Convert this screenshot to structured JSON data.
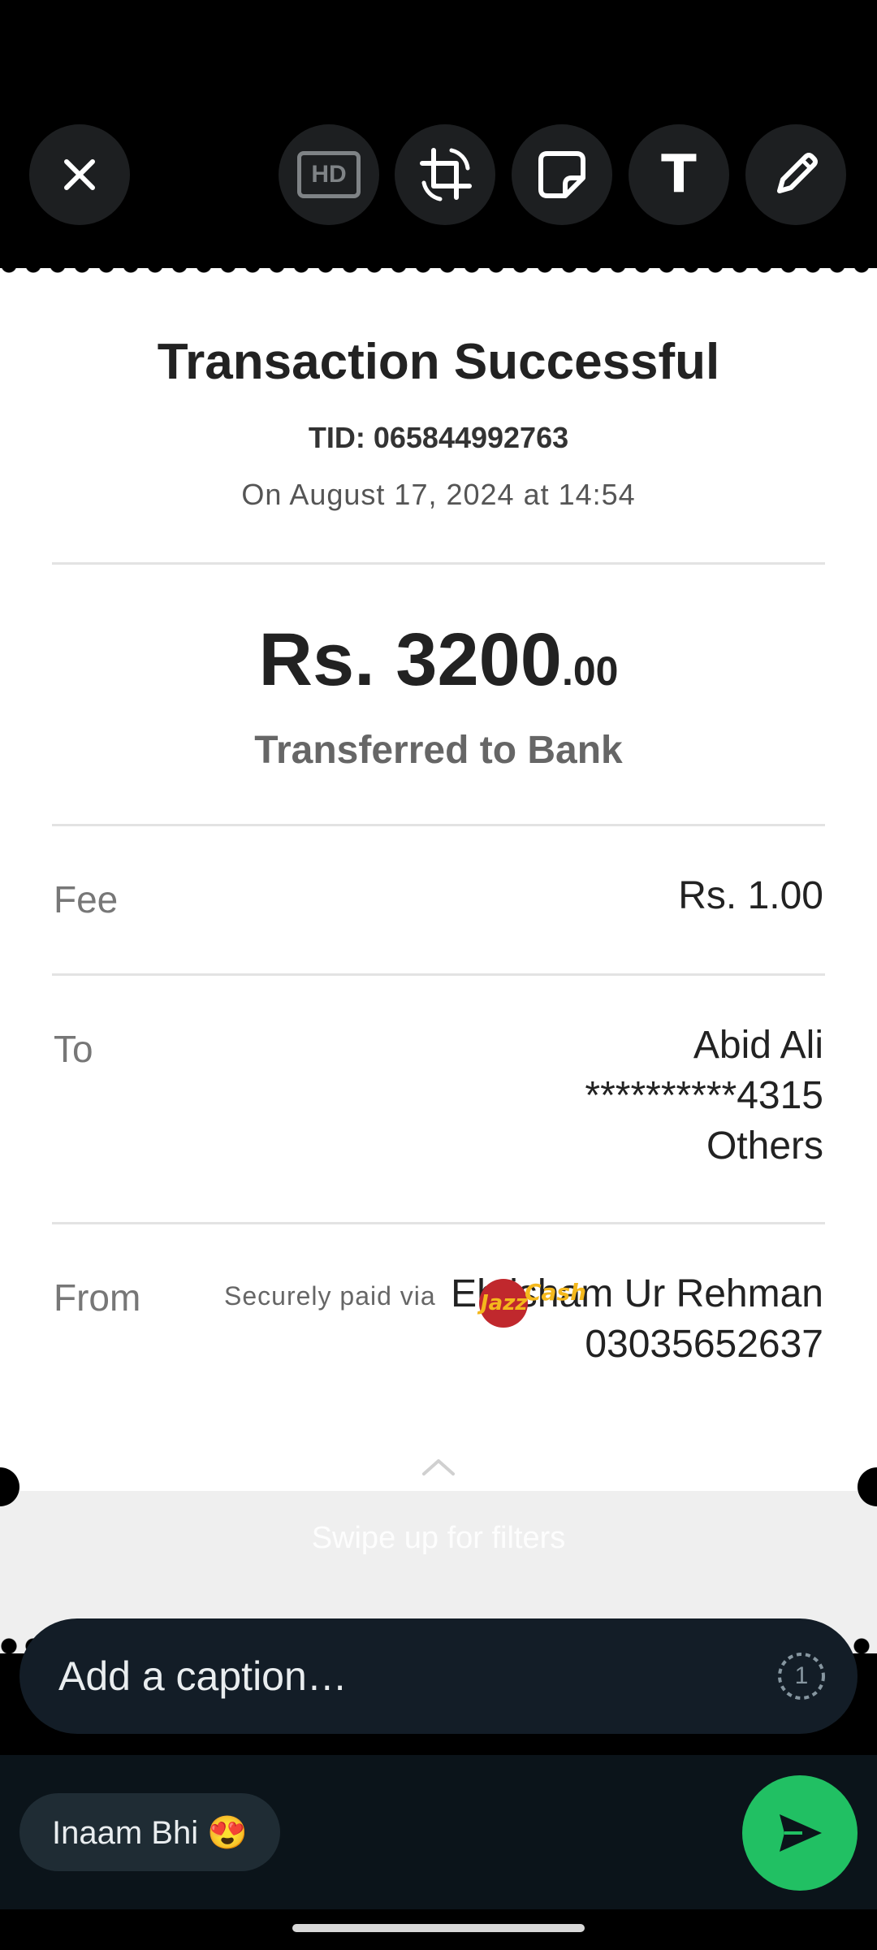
{
  "toolbar": {
    "close_icon": "close-icon",
    "hd_label": "HD",
    "crop_icon": "crop-rotate-icon",
    "sticker_icon": "sticker-icon",
    "text_tool": "T",
    "pencil_icon": "pencil-icon"
  },
  "receipt": {
    "title": "Transaction Successful",
    "tid": "TID: 065844992763",
    "date": "On August 17, 2024 at 14:54",
    "amount_main": "Rs. 3200",
    "amount_decimal": ".00",
    "subtitle": "Transferred to Bank",
    "fee_label": "Fee",
    "fee_value": "Rs. 1.00",
    "to_label": "To",
    "to_name": "Abid Ali",
    "to_account": "**********4315",
    "to_bank": "Others",
    "from_label": "From",
    "from_name": "Ehtisham Ur Rehman",
    "from_number": "03035652637",
    "secure_text": "Securely paid via",
    "logo_text": "JazzCash"
  },
  "filters_hint": "Swipe up for filters",
  "caption": {
    "placeholder": "Add a caption…",
    "view_once_label": "1"
  },
  "chip": {
    "text": "Inaam Bhi 😍"
  },
  "colors": {
    "send_button": "#21c063",
    "caption_bg": "#131d27",
    "bottom_bar": "#0b141a"
  }
}
